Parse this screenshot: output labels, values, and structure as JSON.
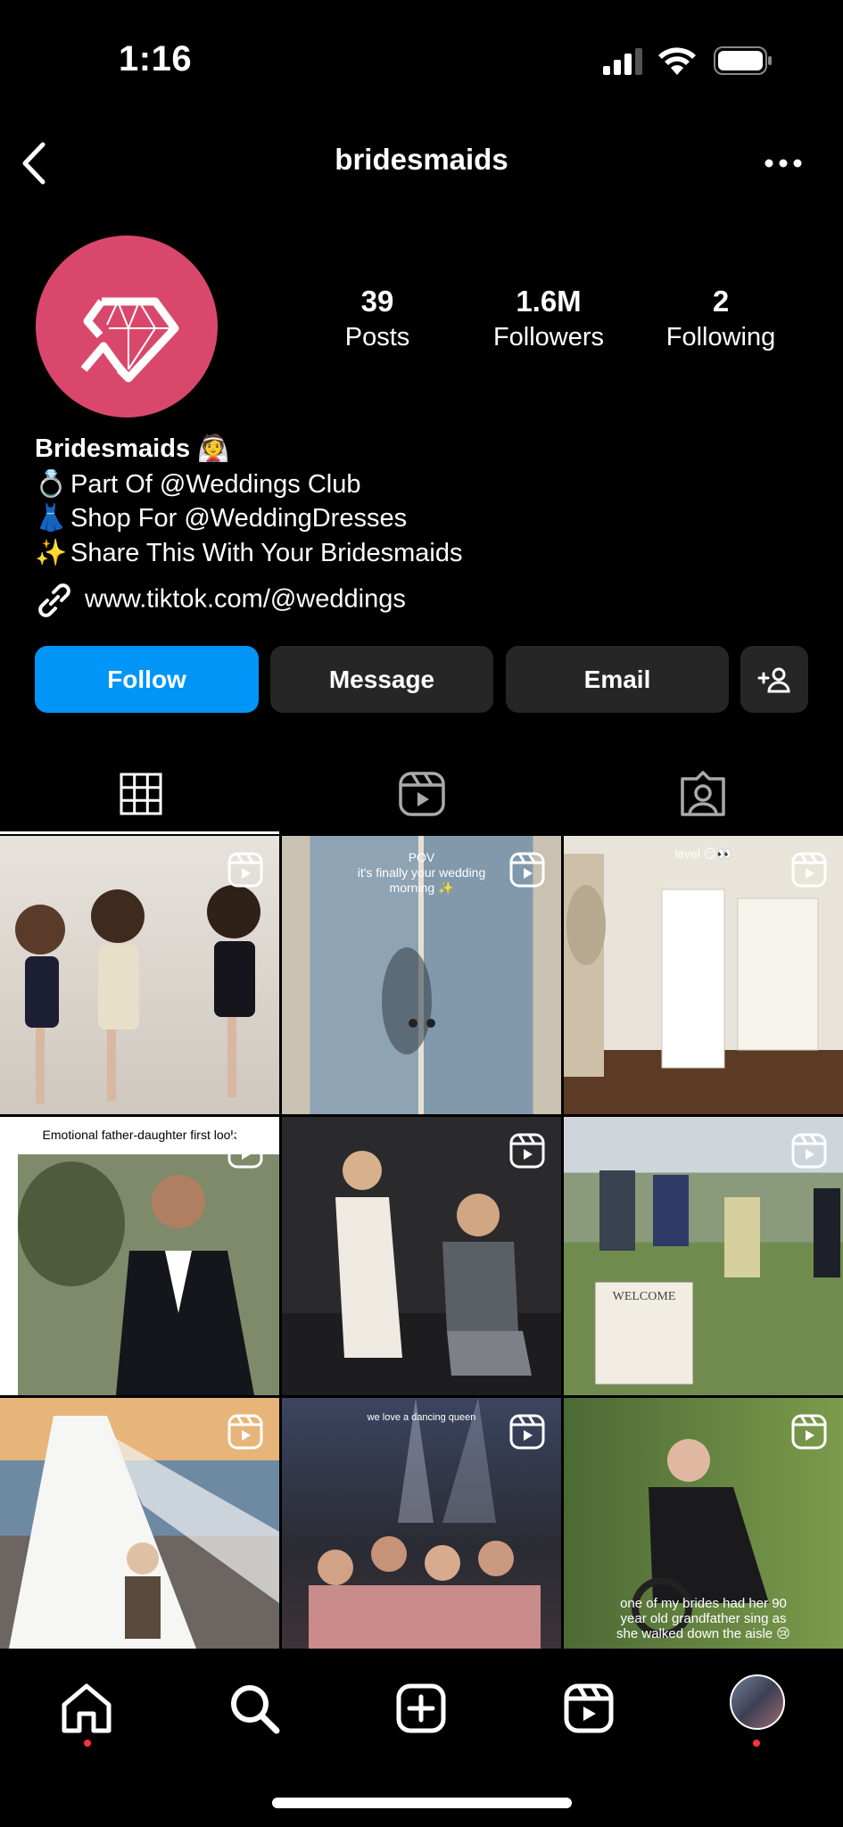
{
  "status_bar": {
    "time": "1:16"
  },
  "header": {
    "title": "bridesmaids",
    "back_icon": "chevron-left-icon",
    "more_icon": "more-horizontal-icon"
  },
  "profile": {
    "brand_color": "#d9486c",
    "stats": [
      {
        "value": "39",
        "label": "Posts"
      },
      {
        "value": "1.6M",
        "label": "Followers"
      },
      {
        "value": "2",
        "label": "Following"
      }
    ],
    "name": "Bridesmaids 👰",
    "bio": [
      {
        "emoji": "💍",
        "text": "Part Of @Weddings Club"
      },
      {
        "emoji": "👗",
        "text": "Shop For @WeddingDresses"
      },
      {
        "emoji": "✨",
        "text": "Share This With Your Bridesmaids"
      }
    ],
    "link": "www.tiktok.com/@weddings"
  },
  "actions": {
    "follow": "Follow",
    "message": "Message",
    "email": "Email",
    "accent": "#0095f6"
  },
  "tabs": [
    "grid-icon",
    "reels-icon",
    "tagged-icon"
  ],
  "grid": {
    "captions": {
      "post_2": "POV\nit's finally your wedding\nmorning ✨",
      "post_3": "level 😏👀",
      "post_4": "Emotional father-daughter first look",
      "post_8": "we love a dancing queen",
      "post_9": "one of my brides had her 90\nyear old grandfather sing as\nshe walked down the aisle 😢"
    }
  },
  "nav": [
    "home-icon",
    "search-icon",
    "create-icon",
    "reels-icon",
    "profile-avatar"
  ],
  "badge_color": "#ff3040"
}
